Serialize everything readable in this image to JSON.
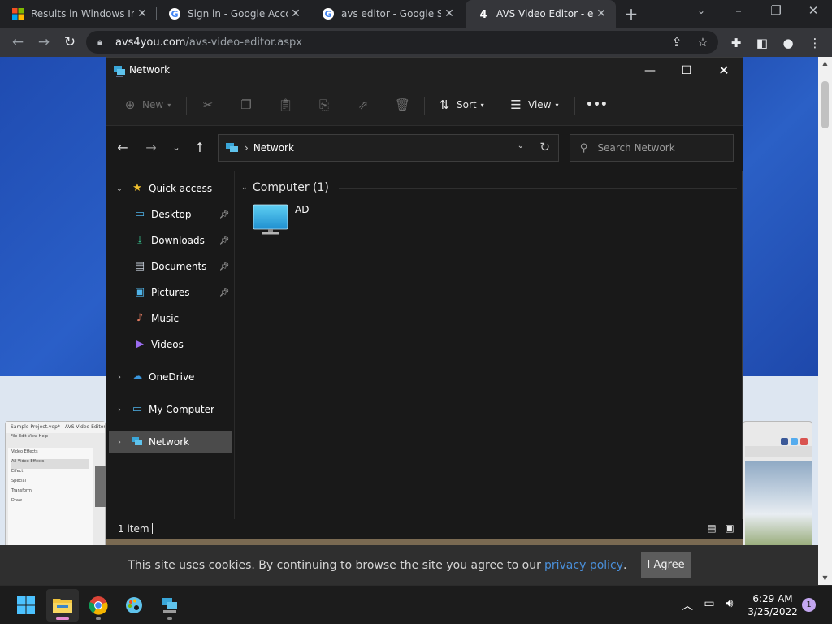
{
  "browser": {
    "tabs": [
      {
        "title": "Results in Windows Ins",
        "favicon": "windows-logo-icon"
      },
      {
        "title": "Sign in - Google Accou",
        "favicon": "google-g-icon"
      },
      {
        "title": "avs editor - Google Se",
        "favicon": "google-g-icon"
      },
      {
        "title": "AVS Video Editor - easy",
        "favicon": "avs-4-icon"
      }
    ],
    "active_tab": 3,
    "url_host": "avs4you.com",
    "url_path": "/avs-video-editor.aspx"
  },
  "explorer": {
    "title": "Network",
    "commands": {
      "new": "New",
      "sort": "Sort",
      "view": "View",
      "more": "•••"
    },
    "address": "Network",
    "search_placeholder": "Search Network",
    "nav": {
      "quick_access": "Quick access",
      "desktop": "Desktop",
      "downloads": "Downloads",
      "documents": "Documents",
      "pictures": "Pictures",
      "music": "Music",
      "videos": "Videos",
      "onedrive": "OneDrive",
      "my_computer": "My Computer",
      "network": "Network"
    },
    "group_title": "Computer (1)",
    "items": [
      {
        "name": "AD",
        "icon": "monitor-icon"
      }
    ],
    "status": "1 item"
  },
  "webpage": {
    "cookie_text": "This site uses cookies. By continuing to browse the site you agree to our",
    "cookie_link": "privacy policy",
    "cookie_end": ".",
    "agree_button": "I Agree",
    "thumb_left_title": "Sample Project.vep* - AVS Video Editor",
    "thumb_left_menu": "File  Edit  View  Help",
    "thumb_left_items": [
      "Video Effects",
      "All Video Effects",
      "Effect",
      "Special",
      "Transform",
      "Draw"
    ]
  },
  "taskbar": {
    "time": "6:29 AM",
    "date": "3/25/2022",
    "notifications": "1"
  },
  "colors": {
    "explorer_bg": "#191919",
    "selected_nav": "#4b4b4b",
    "page_blue": "#1f4bb0",
    "link": "#4a8fd9",
    "active_indicator": "#e68bd2"
  }
}
